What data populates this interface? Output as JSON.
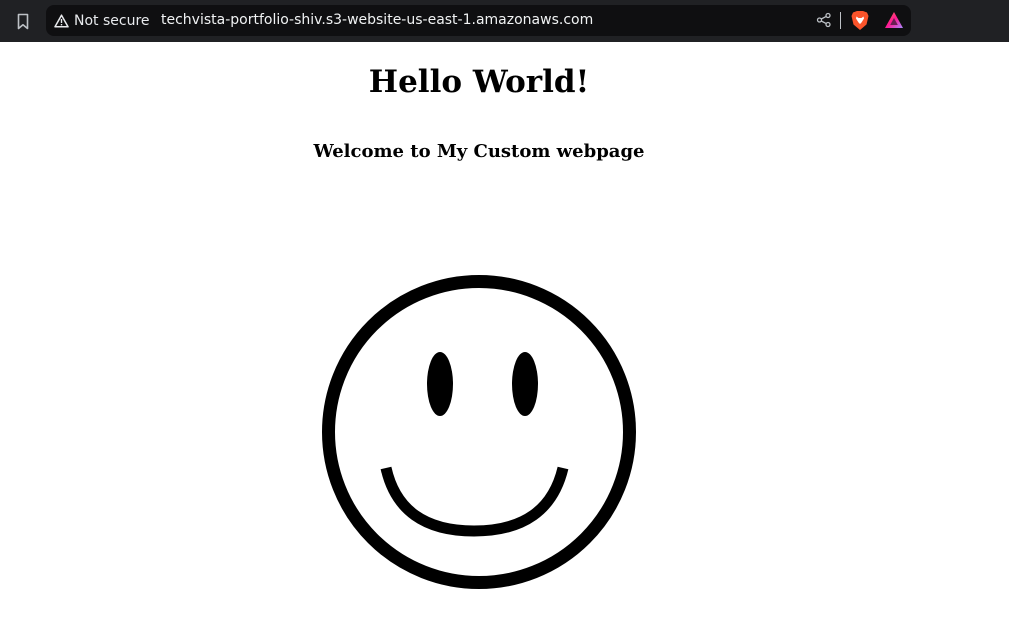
{
  "browser": {
    "security_label": "Not secure",
    "url": "techvista-portfolio-shiv.s3-website-us-east-1.amazonaws.com",
    "icons": {
      "bookmark": "bookmark-icon",
      "warning": "warning-triangle-icon",
      "share": "share-icon",
      "shields": "brave-shields-icon",
      "rewards": "brave-rewards-icon"
    },
    "colors": {
      "toolbar": "#202124",
      "address_bar": "#0f0f11",
      "shields": "#fb542b",
      "rewards": "#a4307d"
    }
  },
  "page": {
    "title": "Hello World!",
    "subtitle": "Welcome to My Custom webpage",
    "image": "smiley-face"
  }
}
